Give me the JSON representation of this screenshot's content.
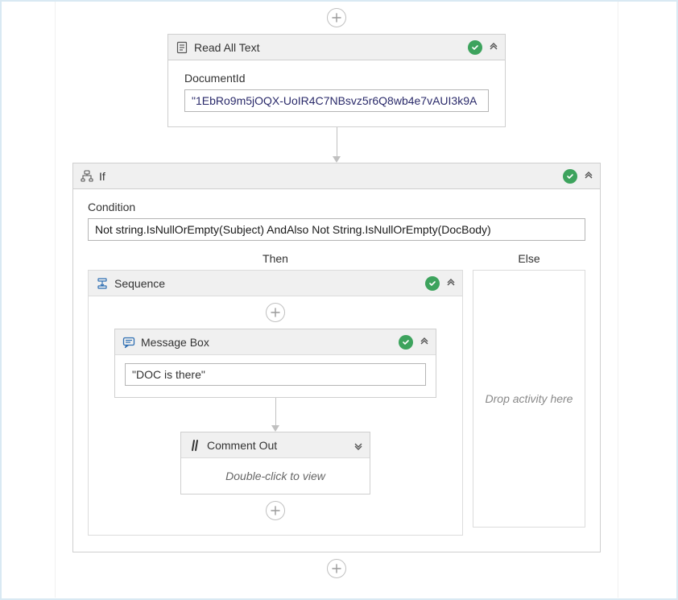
{
  "readAllText": {
    "title": "Read All Text",
    "fieldLabel": "DocumentId",
    "value": "\"1EbRo9m5jOQX-UoIR4C7NBsvz5r6Q8wb4e7vAUI3k9A"
  },
  "ifActivity": {
    "title": "If",
    "conditionLabel": "Condition",
    "conditionValue": "Not string.IsNullOrEmpty(Subject) AndAlso Not String.IsNullOrEmpty(DocBody)",
    "thenLabel": "Then",
    "elseLabel": "Else",
    "elsePlaceholder": "Drop activity here"
  },
  "sequence": {
    "title": "Sequence"
  },
  "messageBox": {
    "title": "Message Box",
    "value": "\"DOC is there\""
  },
  "commentOut": {
    "title": "Comment Out",
    "hint": "Double-click to view"
  }
}
